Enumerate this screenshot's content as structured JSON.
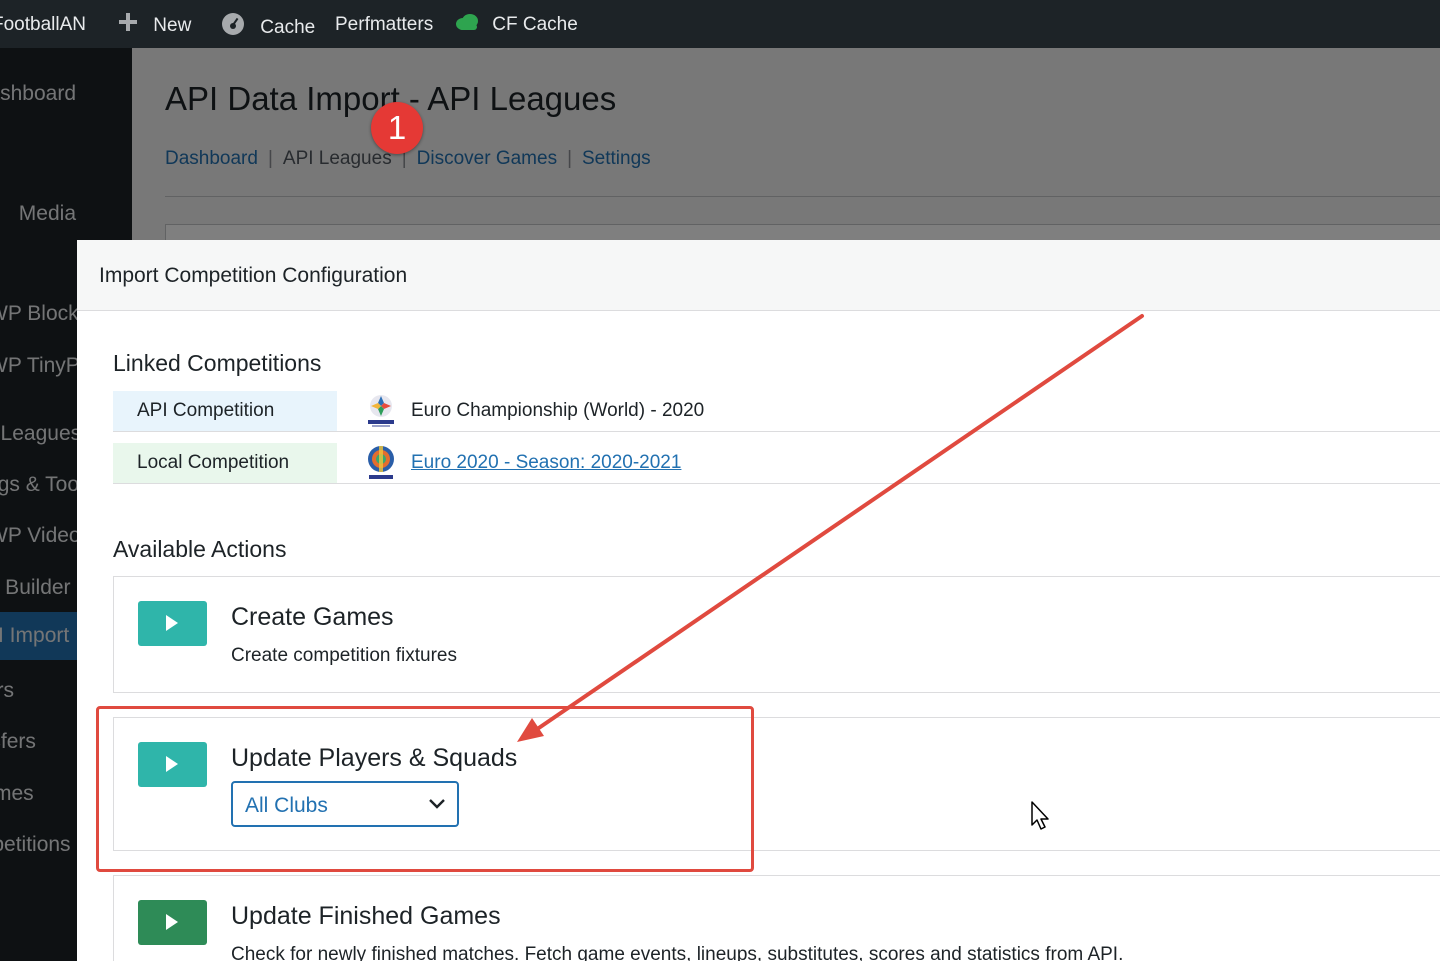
{
  "adminbar": {
    "site_name": "FootballAN",
    "new_label": "New",
    "cache_label": "Cache",
    "perfmatters_label": "Perfmatters",
    "cf_cache_label": "CF Cache"
  },
  "sidebar": {
    "items": [
      {
        "label": "Dashboard"
      },
      {
        "label": "Media"
      },
      {
        "label": "WP Block Manager"
      },
      {
        "label": "WP TinyPNG"
      },
      {
        "label": "Football Leagues"
      },
      {
        "label": "Settings & Tools"
      },
      {
        "label": "WP Videos"
      },
      {
        "label": "Chart Builder"
      },
      {
        "label": "API Import"
      },
      {
        "label": "Players"
      },
      {
        "label": "Transfers"
      },
      {
        "label": "Games"
      },
      {
        "label": "Competitions"
      }
    ],
    "current_index": 8
  },
  "page": {
    "title": "API Data Import - API Leagues",
    "subnav": {
      "dashboard": "Dashboard",
      "api_leagues": "API Leagues",
      "discover_games": "Discover Games",
      "settings": "Settings",
      "separator": "|"
    }
  },
  "annotations": {
    "step_badge": "1",
    "accent_color": "#e04a3f"
  },
  "modal": {
    "title": "Import Competition Configuration",
    "linked_title": "Linked Competitions",
    "api_competition": {
      "label": "API Competition",
      "value": "Euro Championship (World) - 2020",
      "logo_icon": "euro-2024-logo-icon"
    },
    "local_competition": {
      "label": "Local Competition",
      "value": "Euro 2020 - Season: 2020-2021",
      "logo_icon": "euro-2020-logo-icon"
    },
    "actions_title": "Available Actions",
    "actions": [
      {
        "title": "Create Games",
        "description": "Create competition fixtures",
        "button_color": "#2fb5aa"
      },
      {
        "title": "Update Players & Squads",
        "select_value": "All Clubs",
        "button_color": "#2fb5aa"
      },
      {
        "title": "Update Finished Games",
        "description": "Check for newly finished matches. Fetch game events, lineups, substitutes, scores and statistics from API.",
        "button_color": "#2e8b57"
      }
    ]
  }
}
